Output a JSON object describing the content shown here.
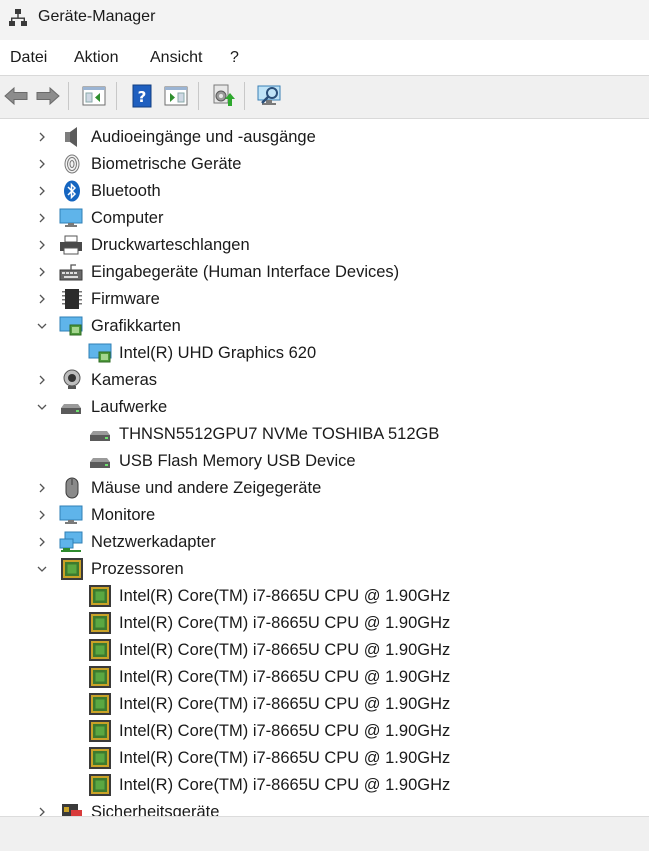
{
  "window": {
    "title": "Geräte-Manager"
  },
  "menu": {
    "file": "Datei",
    "action": "Aktion",
    "view": "Ansicht",
    "help": "?"
  },
  "tree": {
    "audio": "Audioeingänge und -ausgänge",
    "biometric": "Biometrische Geräte",
    "bluetooth": "Bluetooth",
    "computer": "Computer",
    "print_queues": "Druckwarteschlangen",
    "hid": "Eingabegeräte (Human Interface Devices)",
    "firmware": "Firmware",
    "display_adapters": "Grafikkarten",
    "gpu": "Intel(R) UHD Graphics 620",
    "cameras": "Kameras",
    "drives": "Laufwerke",
    "drive_1": "THNSN5512GPU7 NVMe TOSHIBA 512GB",
    "drive_2": "USB Flash Memory USB Device",
    "mice": "Mäuse und andere Zeigegeräte",
    "monitors": "Monitore",
    "network": "Netzwerkadapter",
    "processors": "Prozessoren",
    "cpus": [
      "Intel(R) Core(TM) i7-8665U CPU @ 1.90GHz",
      "Intel(R) Core(TM) i7-8665U CPU @ 1.90GHz",
      "Intel(R) Core(TM) i7-8665U CPU @ 1.90GHz",
      "Intel(R) Core(TM) i7-8665U CPU @ 1.90GHz",
      "Intel(R) Core(TM) i7-8665U CPU @ 1.90GHz",
      "Intel(R) Core(TM) i7-8665U CPU @ 1.90GHz",
      "Intel(R) Core(TM) i7-8665U CPU @ 1.90GHz",
      "Intel(R) Core(TM) i7-8665U CPU @ 1.90GHz"
    ],
    "security": "Sicherheitsgeräte"
  }
}
